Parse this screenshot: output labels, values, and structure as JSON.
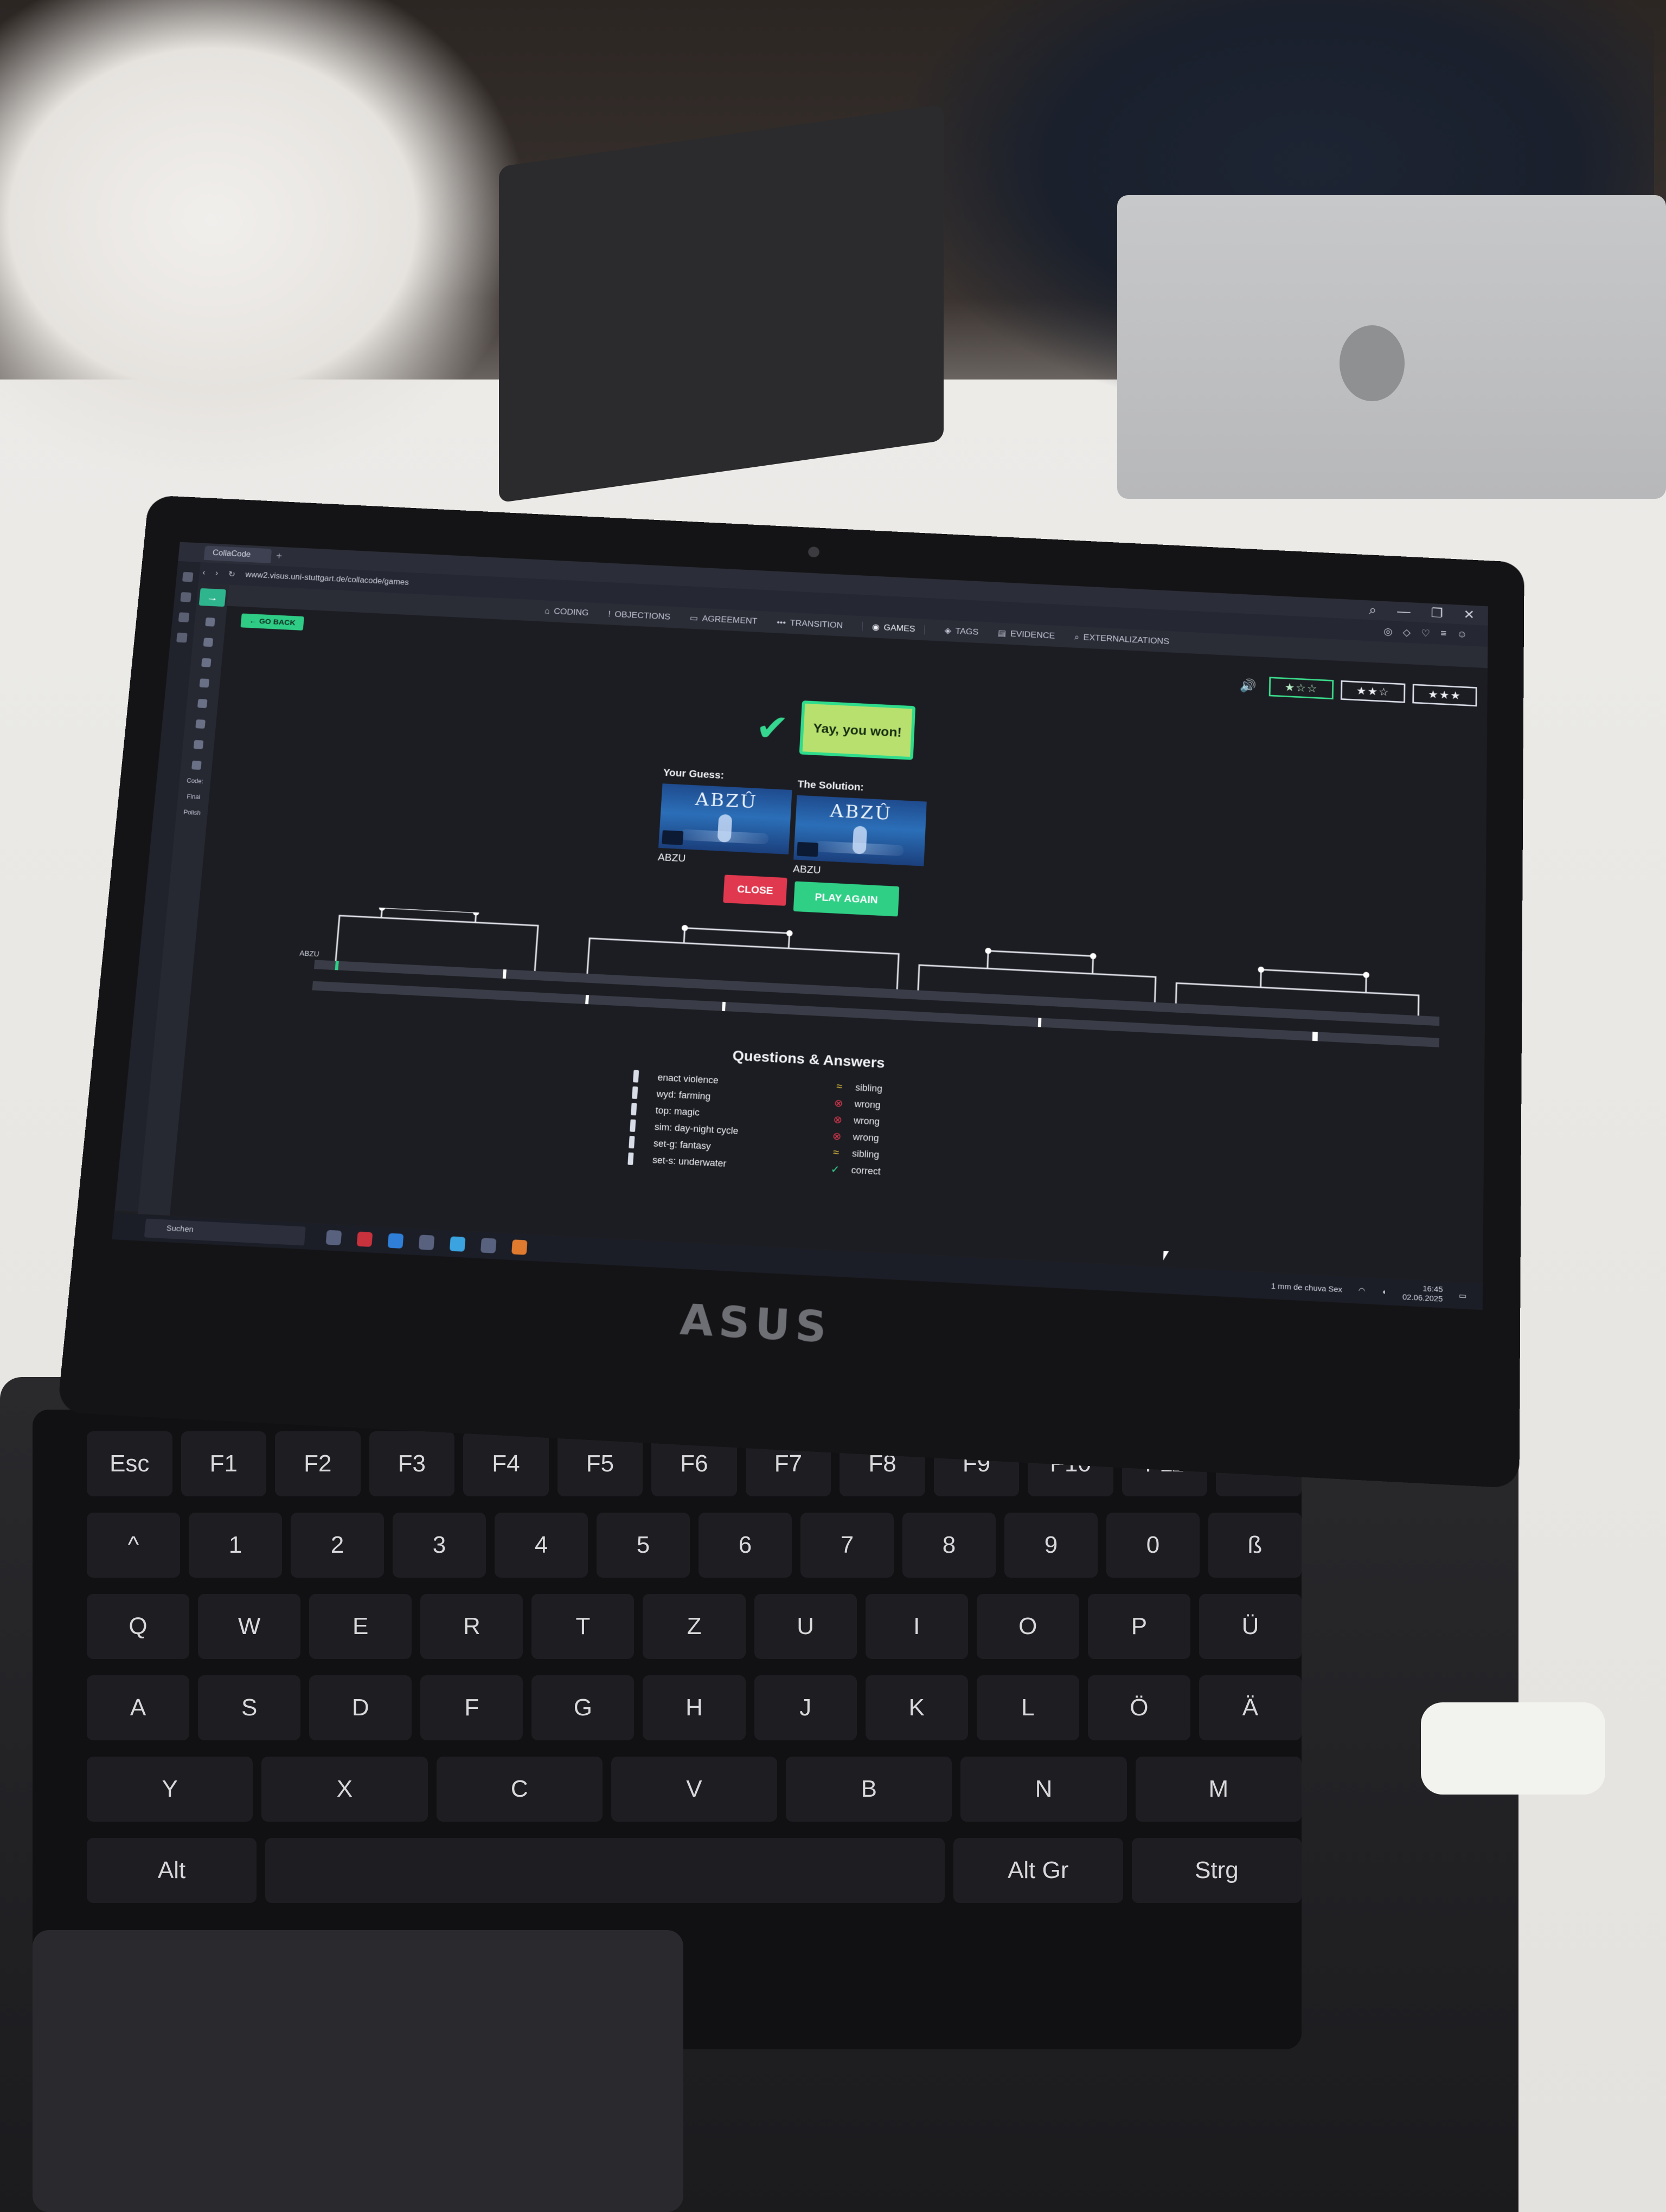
{
  "browser": {
    "tab_title": "CollaCode",
    "url": "www2.visus.uni-stuttgart.de/collacode/games"
  },
  "nav": {
    "items": [
      {
        "icon": "tag-icon",
        "label": "CODING"
      },
      {
        "icon": "exclamation-icon",
        "label": "OBJECTIONS"
      },
      {
        "icon": "chat-icon",
        "label": "AGREEMENT"
      },
      {
        "icon": "dots-icon",
        "label": "TRANSITION"
      },
      {
        "icon": "gamepad-icon",
        "label": "GAMES"
      },
      {
        "icon": "tags-icon",
        "label": "TAGS"
      },
      {
        "icon": "document-icon",
        "label": "EVIDENCE"
      },
      {
        "icon": "search-icon",
        "label": "EXTERNALIZATIONS"
      }
    ],
    "active": "GAMES"
  },
  "go_back_label": "← GO BACK",
  "sidebar": {
    "labels": [
      "Code:",
      "Final",
      "Polish"
    ]
  },
  "difficulty": {
    "options": [
      "★☆☆",
      "★★☆",
      "★★★"
    ],
    "selected_index": 0
  },
  "result": {
    "message": "Yay, you won!",
    "your_guess_label": "Your Guess:",
    "solution_label": "The Solution:",
    "guess_game": "ABZU",
    "solution_game": "ABZU",
    "cover_title": "ABZÛ"
  },
  "buttons": {
    "close": "CLOSE",
    "play_again": "PLAY AGAIN"
  },
  "tree": {
    "leaf_label": "ABZU"
  },
  "qa": {
    "title": "Questions & Answers",
    "questions": [
      "enact violence",
      "wyd: farming",
      "top: magic",
      "sim: day-night cycle",
      "set-g: fantasy",
      "set-s: underwater"
    ],
    "answers": [
      {
        "icon": "approx-icon",
        "text": "sibling",
        "color": "#e6c33c"
      },
      {
        "icon": "x-circle-icon",
        "text": "wrong",
        "color": "#e0394f"
      },
      {
        "icon": "x-circle-icon",
        "text": "wrong",
        "color": "#e0394f"
      },
      {
        "icon": "x-circle-icon",
        "text": "wrong",
        "color": "#e0394f"
      },
      {
        "icon": "approx-icon",
        "text": "sibling",
        "color": "#e6c33c"
      },
      {
        "icon": "check-icon",
        "text": "correct",
        "color": "#35d68f"
      }
    ]
  },
  "taskbar": {
    "search_placeholder": "Suchen",
    "weather": "1 mm de chuva Sex",
    "time": "16:45",
    "date": "02.06.2025"
  },
  "colors": {
    "accent_green": "#2fcf86",
    "danger_red": "#e0394f"
  }
}
